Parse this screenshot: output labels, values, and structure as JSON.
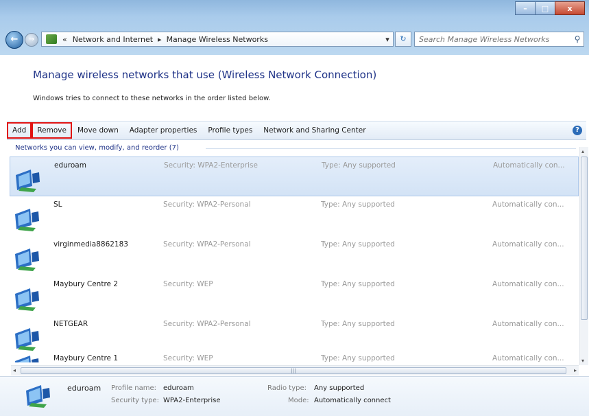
{
  "window": {
    "controls": {
      "minimize": "–",
      "maximize": "□",
      "close": "x"
    }
  },
  "nav": {
    "back_glyph": "←",
    "forward_glyph": "→",
    "chevron": "«",
    "breadcrumb": [
      "Network and Internet",
      "Manage Wireless Networks"
    ],
    "separator": "▸",
    "dropdown_glyph": "▾",
    "refresh_glyph": "↻",
    "search_placeholder": "Search Manage Wireless Networks",
    "search_icon": "⚲"
  },
  "main": {
    "title": "Manage wireless networks that use (Wireless Network Connection)",
    "description": "Windows tries to connect to these networks in the order listed below."
  },
  "toolbar": {
    "add": "Add",
    "remove": "Remove",
    "move_down": "Move down",
    "adapter_properties": "Adapter properties",
    "profile_types": "Profile types",
    "network_sharing": "Network and Sharing Center",
    "help": "?"
  },
  "list": {
    "group_header": "Networks you can view, modify, and reorder (7)",
    "networks": [
      {
        "name": "eduroam",
        "security": "Security: WPA2-Enterprise",
        "type": "Type: Any supported",
        "mode": "Automatically con..."
      },
      {
        "name": "SL",
        "security": "Security: WPA2-Personal",
        "type": "Type: Any supported",
        "mode": "Automatically con..."
      },
      {
        "name": "virginmedia8862183",
        "security": "Security: WPA2-Personal",
        "type": "Type: Any supported",
        "mode": "Automatically con..."
      },
      {
        "name": "Maybury Centre 2",
        "security": "Security: WEP",
        "type": "Type: Any supported",
        "mode": "Automatically con..."
      },
      {
        "name": "NETGEAR",
        "security": "Security: WPA2-Personal",
        "type": "Type: Any supported",
        "mode": "Automatically con..."
      },
      {
        "name": "Maybury Centre 1",
        "security": "Security: WEP",
        "type": "Type: Any supported",
        "mode": "Automatically con..."
      }
    ]
  },
  "scroll": {
    "up": "▴",
    "down": "▾",
    "left": "◂",
    "right": "▸",
    "grip": "|||"
  },
  "details": {
    "name": "eduroam",
    "profile_name_label": "Profile name:",
    "profile_name": "eduroam",
    "security_type_label": "Security type:",
    "security_type": "WPA2-Enterprise",
    "radio_type_label": "Radio type:",
    "radio_type": "Any supported",
    "mode_label": "Mode:",
    "mode": "Automatically connect"
  },
  "colors": {
    "title_blue": "#1e3287",
    "highlight_red": "#e01414",
    "selection": "#d3e3f6",
    "muted_text": "#9a9a9a"
  }
}
